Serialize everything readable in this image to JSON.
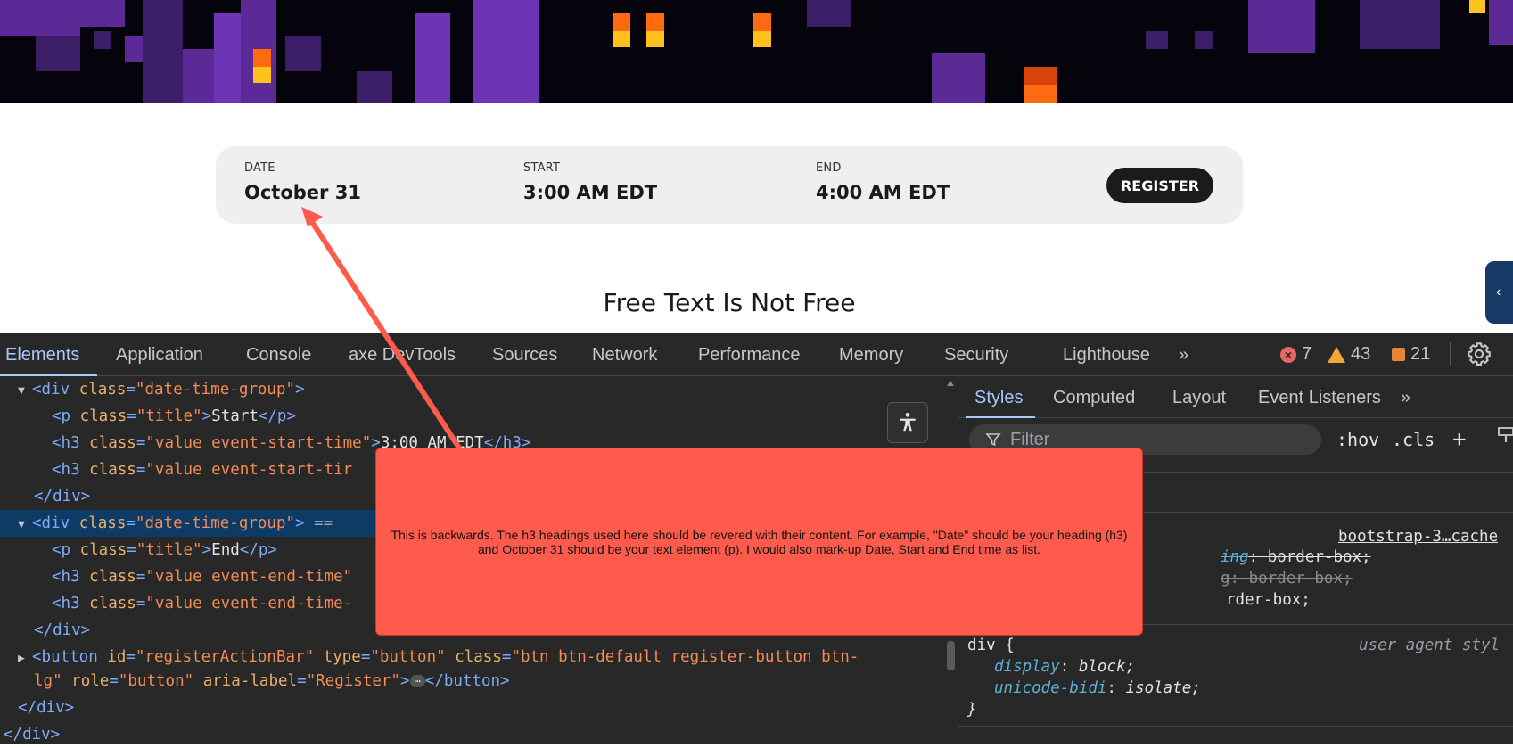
{
  "page": {
    "event_info": {
      "date_label": "DATE",
      "date_value": "October 31",
      "start_label": "START",
      "start_value": "3:00 AM EDT",
      "end_label": "END",
      "end_value": "4:00 AM EDT",
      "register_label": "REGISTER"
    },
    "heading": "Free Text Is Not Free",
    "side_tab_icon": "chevron-left-icon"
  },
  "devtools": {
    "tabs": [
      "Elements",
      "Application",
      "Console",
      "axe DevTools",
      "Sources",
      "Network",
      "Performance",
      "Memory",
      "Security",
      "Lighthouse"
    ],
    "active_tab": "Elements",
    "more_tabs": "»",
    "error_count": "7",
    "warning_count": "43",
    "issue_count": "21",
    "styles_tabs": [
      "Styles",
      "Computed",
      "Layout",
      "Event Listeners"
    ],
    "styles_more": "»",
    "filter_placeholder": "Filter",
    "hov": ":hov",
    "cls": ".cls",
    "code": {
      "l1_tag_open": "<div ",
      "l1_attr": "class",
      "l1_val": "\"date-time-group\"",
      "l1_close": ">",
      "l2_p_open": "<p ",
      "l2_attr": "class",
      "l2_val": "\"title\"",
      "l2_gt": ">",
      "l2_text": "Start",
      "l2_end": "</p>",
      "l3_open": "<h3 ",
      "l3_attr": "class",
      "l3_val": "\"value event-start-time\"",
      "l3_gt": ">",
      "l3_text": "3:00 AM EDT",
      "l3_end": "</h3>",
      "l4_open": "<h3 ",
      "l4_attr": "class",
      "l4_val": "\"value event-start-tir",
      "l5_close": "</div>",
      "l6_open": "<div ",
      "l6_attr": "class",
      "l6_val": "\"date-time-group\"",
      "l6_gt": ">",
      "l6_eq": " == ",
      "l7_p_open": "<p ",
      "l7_attr": "class",
      "l7_val": "\"title\"",
      "l7_gt": ">",
      "l7_text": "End",
      "l7_end": "</p>",
      "l8_open": "<h3 ",
      "l8_attr": "class",
      "l8_val": "\"value event-end-time\"",
      "l9_open": "<h3 ",
      "l9_attr": "class",
      "l9_val": "\"value event-end-time-",
      "l10_close": "</div>",
      "l11_open": "<button ",
      "l11_a1": "id",
      "l11_v1": "\"registerActionBar\"",
      "l11_a2": "type",
      "l11_v2": "\"button\"",
      "l11_a3": "class",
      "l11_v3": "\"btn btn-default register-button btn-",
      "l12_v3": "lg\"",
      "l12_a4": "role",
      "l12_v4": "\"button\"",
      "l12_a5": "aria-label",
      "l12_v5": "\"Register\"",
      "l12_gt": ">",
      "l12_ellipsis": "⋯",
      "l12_end": "</button>",
      "l13_close": "</div>",
      "l14_close": "</div>"
    },
    "css": {
      "source": "bootstrap-3…cache",
      "r1_prop": "ing",
      "r1_val": "border-box;",
      "r2_prop": "g",
      "r2_val": "border-box;",
      "r3_val": "rder-box;",
      "div_selector": "div {",
      "ua_label": "user agent styl",
      "display_prop": "display",
      "display_val": "block;",
      "bidi_prop": "unicode-bidi",
      "bidi_val": "isolate;",
      "close_brace": "}"
    }
  },
  "annotation": {
    "text": "This is backwards. The h3 headings used here should be revered with their content. For example, \"Date\" should be your heading (h3) and October 31 should be your text element (p). I would also mark-up Date, Start and End time as list.",
    "color": "#ff5b4d"
  }
}
